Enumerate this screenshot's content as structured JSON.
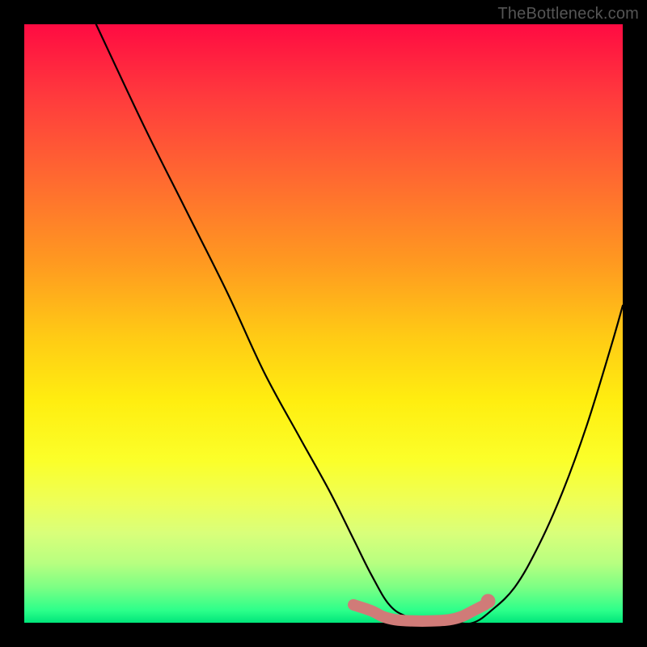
{
  "watermark": "TheBottleneck.com",
  "chart_data": {
    "type": "line",
    "title": "",
    "xlabel": "",
    "ylabel": "",
    "xlim": [
      0,
      100
    ],
    "ylim": [
      0,
      100
    ],
    "grid": false,
    "legend": false,
    "series": [
      {
        "name": "bottleneck-curve",
        "color": "#000000",
        "x": [
          12,
          20,
          27,
          34,
          40,
          46,
          51,
          55,
          58,
          61,
          64,
          68,
          72,
          75,
          78,
          82,
          86,
          90,
          94,
          98,
          100
        ],
        "y": [
          100,
          83,
          69,
          55,
          42,
          31,
          22,
          14,
          8,
          3,
          1,
          0,
          0,
          0,
          2,
          6,
          13,
          22,
          33,
          46,
          53
        ]
      },
      {
        "name": "valley-highlight",
        "color": "#d07b78",
        "x": [
          55,
          58,
          60,
          62,
          65,
          68,
          71,
          73,
          75,
          77
        ],
        "y": [
          3,
          2,
          1,
          0.5,
          0.3,
          0.3,
          0.5,
          1,
          2,
          3
        ]
      }
    ],
    "highlight_dot": {
      "x": 77.5,
      "y": 3.6,
      "color": "#d07b78"
    }
  }
}
